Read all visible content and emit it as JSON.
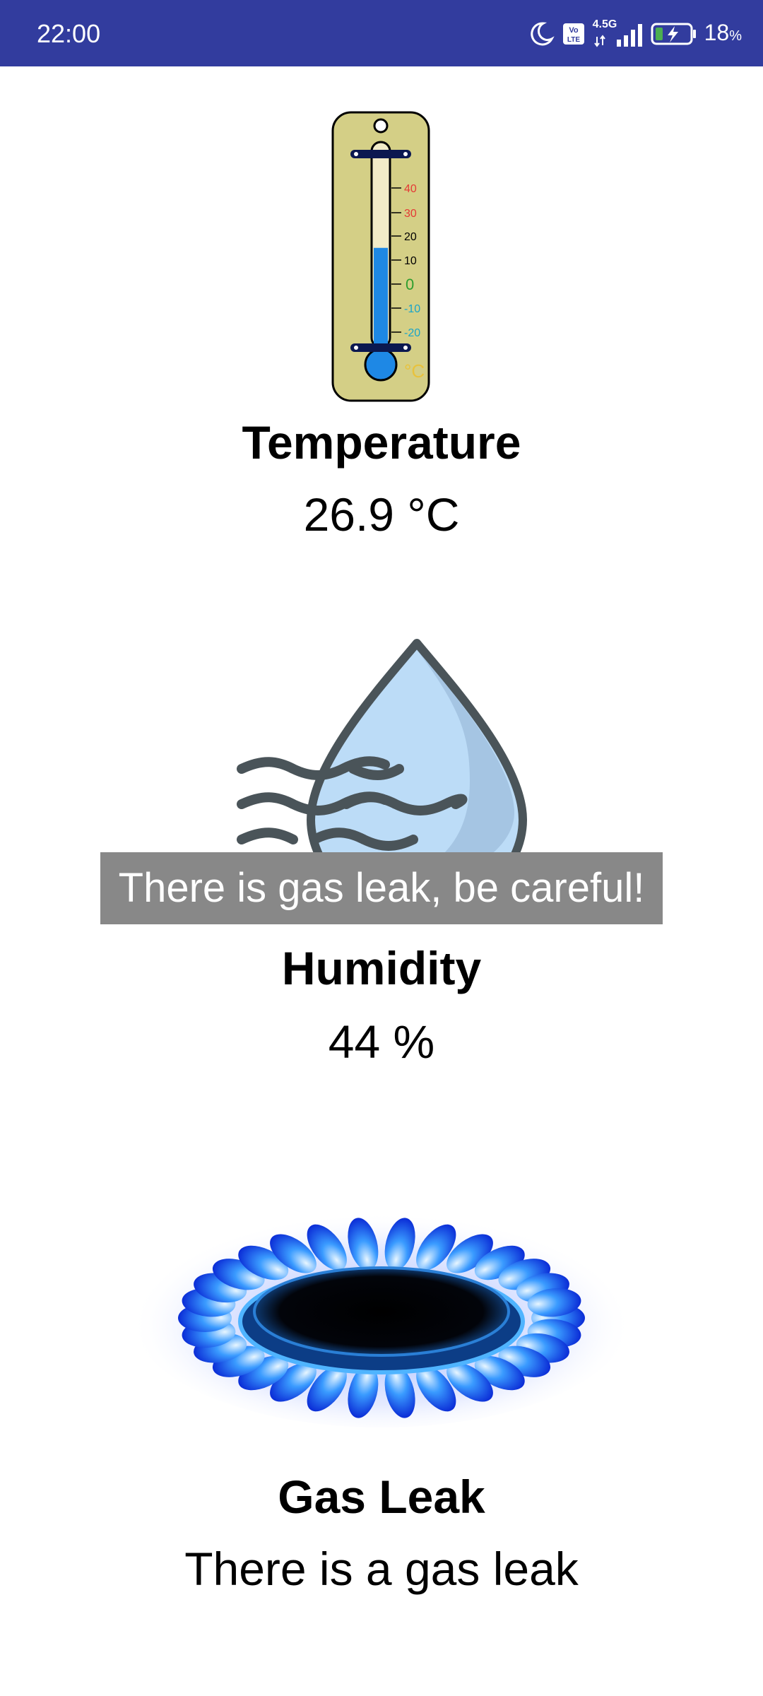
{
  "status_bar": {
    "time": "22:00",
    "battery_percent": "18",
    "battery_unit": "%",
    "network_label": "4.5G",
    "volte_label": "Vo LTE"
  },
  "temperature": {
    "title": "Temperature",
    "value": "26.9 °C",
    "icon": "thermometer-icon",
    "scale_labels": [
      "40",
      "30",
      "20",
      "10",
      "0",
      "-10",
      "-20"
    ],
    "scale_unit": "°C",
    "fill_level": 0.51
  },
  "humidity": {
    "title": "Humidity",
    "value": "44 %",
    "icon": "humidity-drop-icon"
  },
  "gas": {
    "title": "Gas Leak",
    "value": "There is a gas leak",
    "icon": "gas-burner-icon"
  },
  "toast": {
    "message": "There is gas leak, be careful!"
  },
  "colors": {
    "status_bar": "#323c9e",
    "toast_background": "#888888",
    "thermometer_body": "#d4cf86",
    "mercury": "#1e88e5",
    "flame_blue": "#1565ff"
  }
}
